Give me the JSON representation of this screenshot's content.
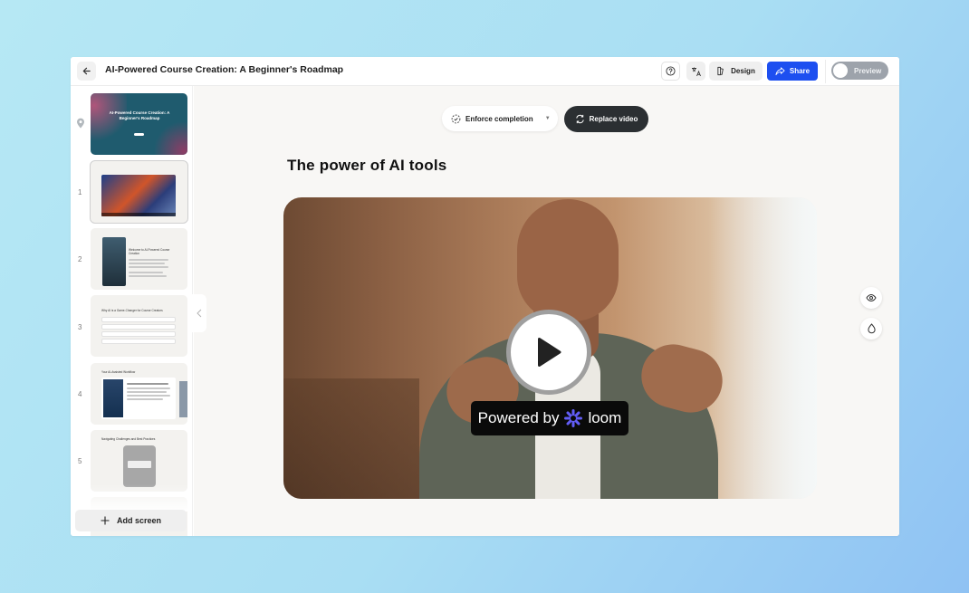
{
  "header": {
    "title": "AI-Powered Course Creation: A Beginner's Roadmap",
    "design_label": "Design",
    "share_label": "Share",
    "preview_label": "Preview"
  },
  "sidebar": {
    "slides": [
      {
        "number": "",
        "cover_title": "AI-Powered Course Creation: A Beginner's Roadmap"
      },
      {
        "number": "1"
      },
      {
        "number": "2",
        "heading": "Welcome to AI-Powered Course Creation"
      },
      {
        "number": "3",
        "heading": "Why AI is a Game-Changer for Course Creators"
      },
      {
        "number": "4",
        "heading": "Your AI-Assisted Workflow"
      },
      {
        "number": "5",
        "heading": "Navigating Challenges and Best Practices"
      }
    ],
    "add_screen_label": "Add screen"
  },
  "toolbar": {
    "enforce_label": "Enforce completion",
    "replace_label": "Replace video"
  },
  "slide": {
    "title": "The power of AI tools"
  },
  "video": {
    "badge_prefix": "Powered by",
    "badge_brand": "loom"
  },
  "colors": {
    "share_blue": "#1d4ff0",
    "replace_dark": "#2b2f32",
    "loom_purple": "#625df5"
  }
}
